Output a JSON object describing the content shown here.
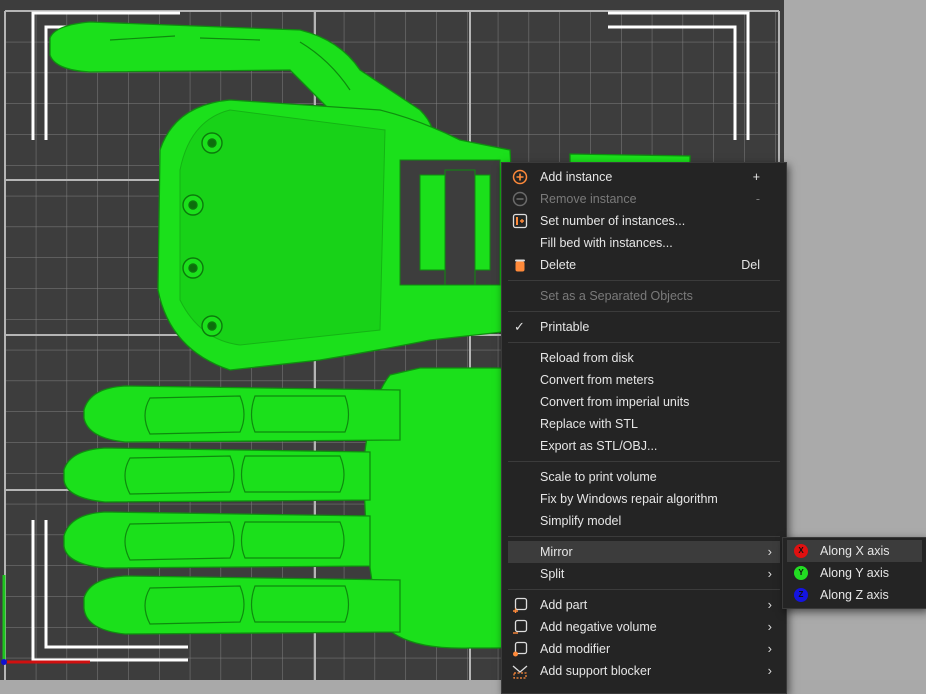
{
  "context_menu": {
    "items": [
      {
        "label": "Add instance",
        "shortcut": "+"
      },
      {
        "label": "Remove instance",
        "shortcut": "-"
      },
      {
        "label": "Set number of instances..."
      },
      {
        "label": "Fill bed with instances..."
      },
      {
        "label": "Delete",
        "shortcut": "Del"
      },
      {
        "label": "Set as a Separated Objects"
      },
      {
        "label": "Printable"
      },
      {
        "label": "Reload from disk"
      },
      {
        "label": "Convert from meters"
      },
      {
        "label": "Convert from imperial units"
      },
      {
        "label": "Replace with STL"
      },
      {
        "label": "Export as STL/OBJ..."
      },
      {
        "label": "Scale to print volume"
      },
      {
        "label": "Fix by Windows repair algorithm"
      },
      {
        "label": "Simplify model"
      },
      {
        "label": "Mirror"
      },
      {
        "label": "Split"
      },
      {
        "label": "Add part"
      },
      {
        "label": "Add negative volume"
      },
      {
        "label": "Add modifier"
      },
      {
        "label": "Add support blocker"
      }
    ]
  },
  "mirror_submenu": {
    "items": [
      {
        "label": "Along X axis",
        "axis": "X",
        "color": "#e01010"
      },
      {
        "label": "Along Y axis",
        "axis": "Y",
        "color": "#22dd22"
      },
      {
        "label": "Along Z axis",
        "axis": "Z",
        "color": "#1414e0"
      }
    ]
  },
  "colors": {
    "bed": "#3f3f3f",
    "model": "#1be01b",
    "menu_bg": "#242424"
  }
}
